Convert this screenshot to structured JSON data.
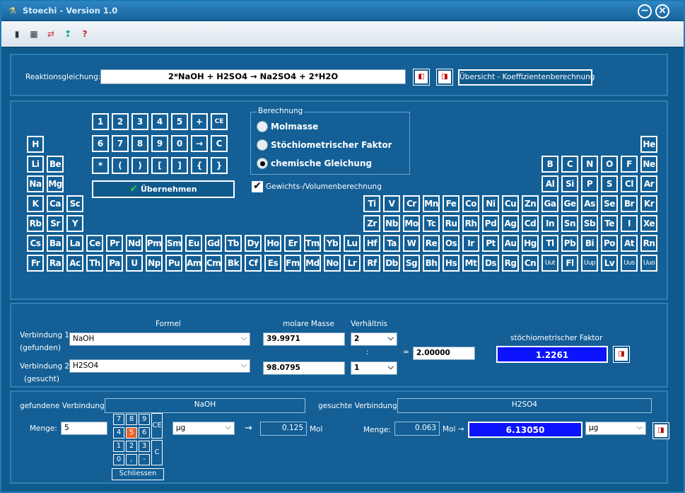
{
  "window": {
    "title": "Stoechi - Version 1.0"
  },
  "reaction": {
    "label": "Reaktionsgleichung:",
    "equation": "2*NaOH + H2SO4 → Na2SO4 + 2*H2O",
    "overview_button": "Übersicht - Koeffizientenberechnung"
  },
  "keypad": {
    "row1": [
      "1",
      "2",
      "3",
      "4",
      "5",
      "+",
      "CE"
    ],
    "row2": [
      "6",
      "7",
      "8",
      "9",
      "0",
      "→",
      "C"
    ],
    "row3": [
      "*",
      "(",
      ")",
      "[",
      "]",
      "{",
      "}"
    ],
    "apply_button": "Übernehmen"
  },
  "calc": {
    "group_label": "Berechnung",
    "options": [
      "Molmasse",
      "Stöchiometrischer Faktor",
      "chemische Gleichung"
    ],
    "selected": "chemische Gleichung",
    "weight_volume_label": "Gewichts-/Volumenberechnung"
  },
  "periodic": {
    "p1": [
      "H",
      "He"
    ],
    "p2": [
      "Li",
      "Be",
      "B",
      "C",
      "N",
      "O",
      "F",
      "Ne"
    ],
    "p3": [
      "Na",
      "Mg",
      "Al",
      "Si",
      "P",
      "S",
      "Cl",
      "Ar"
    ],
    "p4": [
      "K",
      "Ca",
      "Sc",
      "Ti",
      "V",
      "Cr",
      "Mn",
      "Fe",
      "Co",
      "Ni",
      "Cu",
      "Zn",
      "Ga",
      "Ge",
      "As",
      "Se",
      "Br",
      "Kr"
    ],
    "p5": [
      "Rb",
      "Sr",
      "Y",
      "Zr",
      "Nb",
      "Mo",
      "Tc",
      "Ru",
      "Rh",
      "Pd",
      "Ag",
      "Cd",
      "In",
      "Sn",
      "Sb",
      "Te",
      "I",
      "Xe"
    ],
    "p6": [
      "Cs",
      "Ba",
      "La",
      "Ce",
      "Pr",
      "Nd",
      "Pm",
      "Sm",
      "Eu",
      "Gd",
      "Tb",
      "Dy",
      "Ho",
      "Er",
      "Tm",
      "Yb",
      "Lu",
      "Hf",
      "Ta",
      "W",
      "Re",
      "Os",
      "Ir",
      "Pt",
      "Au",
      "Hg",
      "Tl",
      "Pb",
      "Bi",
      "Po",
      "At",
      "Rn"
    ],
    "p7": [
      "Fr",
      "Ra",
      "Ac",
      "Th",
      "Pa",
      "U",
      "Np",
      "Pu",
      "Am",
      "Cm",
      "Bk",
      "Cf",
      "Es",
      "Fm",
      "Md",
      "No",
      "Lr",
      "Rf",
      "Db",
      "Sg",
      "Bh",
      "Hs",
      "Mt",
      "Ds",
      "Rg",
      "Cn",
      "Uut",
      "Fl",
      "Uup",
      "Lv",
      "Uus",
      "Uuo"
    ]
  },
  "compounds": {
    "col_formula": "Formel",
    "col_molar": "molare Masse",
    "col_ratio": "Verhältnis",
    "c1_label": "Verbindung 1",
    "c1_sub": "(gefunden)",
    "c1_formula": "NaOH",
    "c1_molar": "39.9971",
    "c1_ratio": "2",
    "c2_label": "Verbindung 2",
    "c2_sub": "(gesucht)",
    "c2_formula": "H2SO4",
    "c2_molar": "98.0795",
    "c2_ratio": "1",
    "colon": ":",
    "equals": "=",
    "ratio_result": "2.00000",
    "factor_label": "stöchiometrischer Faktor",
    "factor_value": "1.2261"
  },
  "amount": {
    "found_label": "gefundene Verbindung:",
    "found_value": "NaOH",
    "sought_label": "gesuchte Verbindung:",
    "sought_value": "H2SO4",
    "menge_label": "Menge:",
    "menge_value": "5",
    "numpad": [
      "7",
      "8",
      "9",
      "4",
      "5",
      "6",
      "1",
      "2",
      "3",
      "0",
      ",",
      "-"
    ],
    "numpad_ce": "CE",
    "numpad_c": "C",
    "close_button": "Schliessen",
    "unit_in": "µg",
    "arrow": "→",
    "mol_in_value": "0.125",
    "mol_label": "Mol",
    "menge2_label": "Menge:",
    "mol_out_value": "0.063",
    "mol_arrow_label": "Mol →",
    "result_value": "6.13050",
    "unit_out": "µg"
  }
}
